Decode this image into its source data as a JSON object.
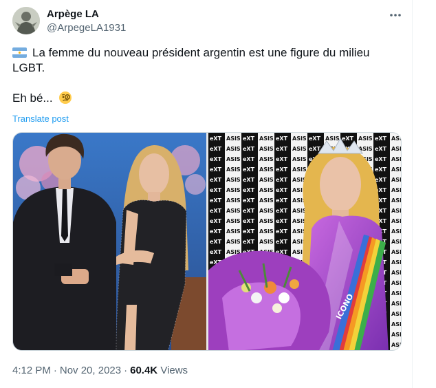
{
  "author": {
    "display_name": "Arpège LA",
    "handle": "@ArpegeLA1931"
  },
  "icons": {
    "more": "more-dots-icon",
    "flag": "argentina-flag-icon",
    "emoji": "face-with-monocle-icon"
  },
  "tweet": {
    "text_line_1": "La femme du nouveau président argentin est une figure du milieu LGBT.",
    "text_line_2": "Eh bé...",
    "translate_label": "Translate post"
  },
  "media": {
    "photo_2_sign_text": "eXTASIS",
    "photo_2_sash_text": "ICONO"
  },
  "meta": {
    "time": "4:12 PM",
    "date": "Nov 20, 2023",
    "separator": "·",
    "views_count": "60.4K",
    "views_label": "Views"
  },
  "colors": {
    "link": "#1d9bf0",
    "secondary_text": "#536471",
    "primary_text": "#0f1419",
    "border": "#cfd9de"
  }
}
